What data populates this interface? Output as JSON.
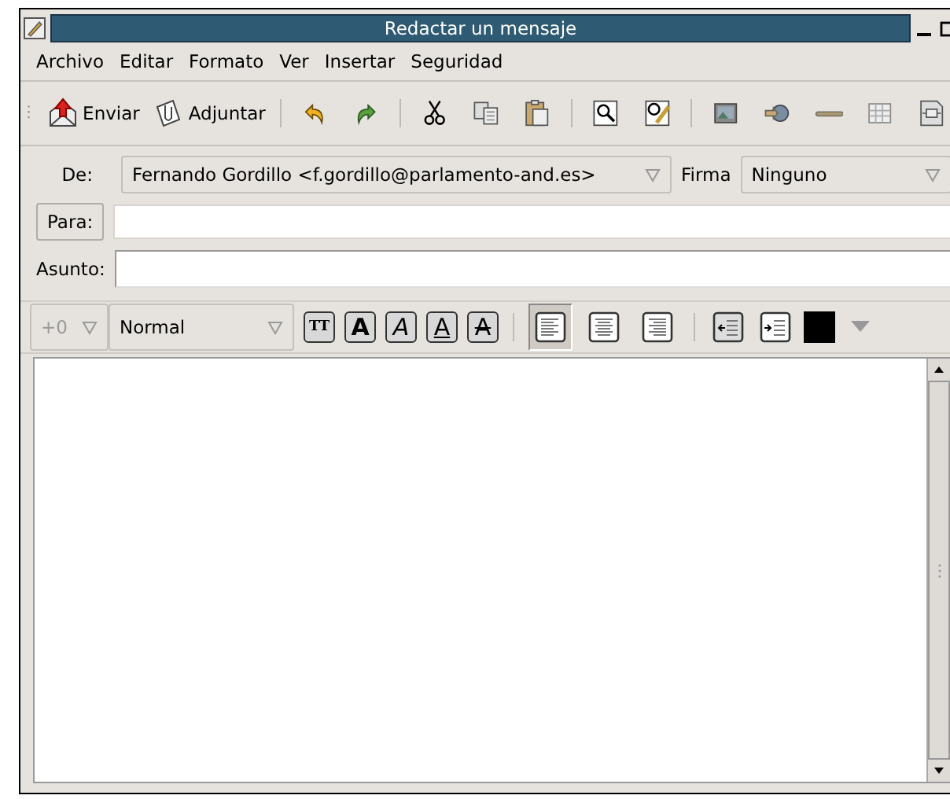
{
  "window": {
    "title": "Redactar un mensaje"
  },
  "menu": [
    "Archivo",
    "Editar",
    "Formato",
    "Ver",
    "Insertar",
    "Seguridad"
  ],
  "toolbar": [
    {
      "kind": "send",
      "label": "Enviar"
    },
    {
      "kind": "attach",
      "label": "Adjuntar"
    },
    {
      "kind": "sep"
    },
    {
      "kind": "undo"
    },
    {
      "kind": "redo"
    },
    {
      "kind": "sep"
    },
    {
      "kind": "cut"
    },
    {
      "kind": "copy"
    },
    {
      "kind": "paste"
    },
    {
      "kind": "sep"
    },
    {
      "kind": "find"
    },
    {
      "kind": "spell"
    },
    {
      "kind": "sep"
    },
    {
      "kind": "image"
    },
    {
      "kind": "link"
    },
    {
      "kind": "rule"
    },
    {
      "kind": "table"
    },
    {
      "kind": "object"
    }
  ],
  "from": {
    "label": "De:",
    "value": "Fernando Gordillo  <f.gordillo@parlamento-and.es>"
  },
  "signature": {
    "label": "Firma",
    "value": "Ninguno"
  },
  "to": {
    "label": "Para:"
  },
  "subject": {
    "label": "Asunto:"
  },
  "format_bar": {
    "size": "+0",
    "style": "Normal",
    "text_buttons": [
      {
        "kind": "tt",
        "label": "TT"
      },
      {
        "kind": "bold",
        "label": "A"
      },
      {
        "kind": "italic",
        "label": "A"
      },
      {
        "kind": "underline",
        "label": "A"
      },
      {
        "kind": "strike",
        "label": "A"
      }
    ],
    "align_buttons": [
      {
        "kind": "left",
        "selected": true
      },
      {
        "kind": "center",
        "selected": false
      },
      {
        "kind": "right",
        "selected": false
      }
    ],
    "indent_buttons": [
      {
        "kind": "outdent"
      },
      {
        "kind": "indent"
      }
    ],
    "color": "#000000"
  }
}
